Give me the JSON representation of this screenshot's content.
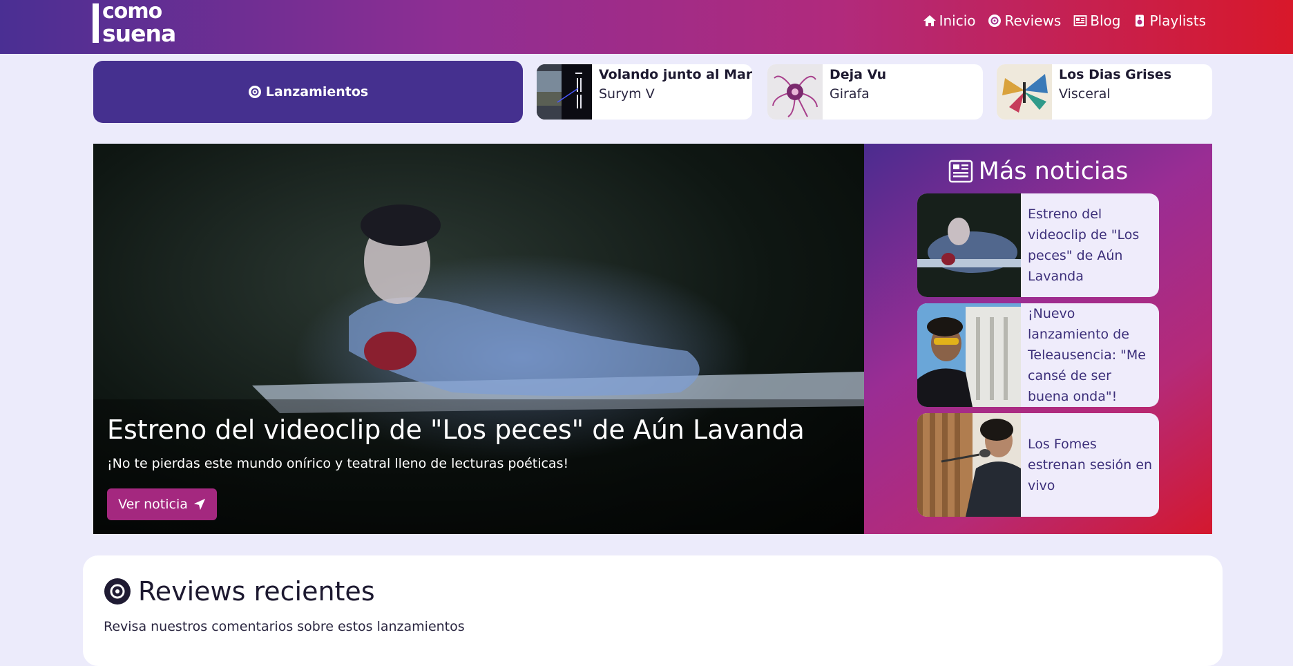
{
  "header": {
    "logo_line1": "como",
    "logo_line2": "suena",
    "nav": [
      {
        "label": "Inicio",
        "icon": "home-icon"
      },
      {
        "label": "Reviews",
        "icon": "vinyl-icon"
      },
      {
        "label": "Blog",
        "icon": "newspaper-icon"
      },
      {
        "label": "Playlists",
        "icon": "speaker-icon"
      }
    ]
  },
  "releases": {
    "button_label": "Lanzamientos",
    "items": [
      {
        "title": "Volando junto al Mar",
        "artist": "Surym V"
      },
      {
        "title": "Deja Vu",
        "artist": "Girafa"
      },
      {
        "title": "Los Dias Grises",
        "artist": "Visceral"
      }
    ]
  },
  "hero": {
    "title": "Estreno del videoclip de \"Los peces\" de Aún Lavanda",
    "subtitle": "¡No te pierdas este mundo onírico y teatral lleno de lecturas poéticas!",
    "button_label": "Ver noticia"
  },
  "more_news": {
    "title": "Más noticias",
    "items": [
      {
        "text": "Estreno del videoclip de \"Los peces\" de Aún Lavanda"
      },
      {
        "text": "¡Nuevo lanzamiento de Teleausencia: \"Me cansé de ser buena onda\"!"
      },
      {
        "text": "Los Fomes estrenan sesión en vivo"
      }
    ]
  },
  "reviews": {
    "title": "Reviews recientes",
    "subtitle": "Revisa nuestros comentarios sobre estos lanzamientos"
  },
  "colors": {
    "accent": "#45308f",
    "button": "#a4287f",
    "background": "#ecebfb"
  }
}
